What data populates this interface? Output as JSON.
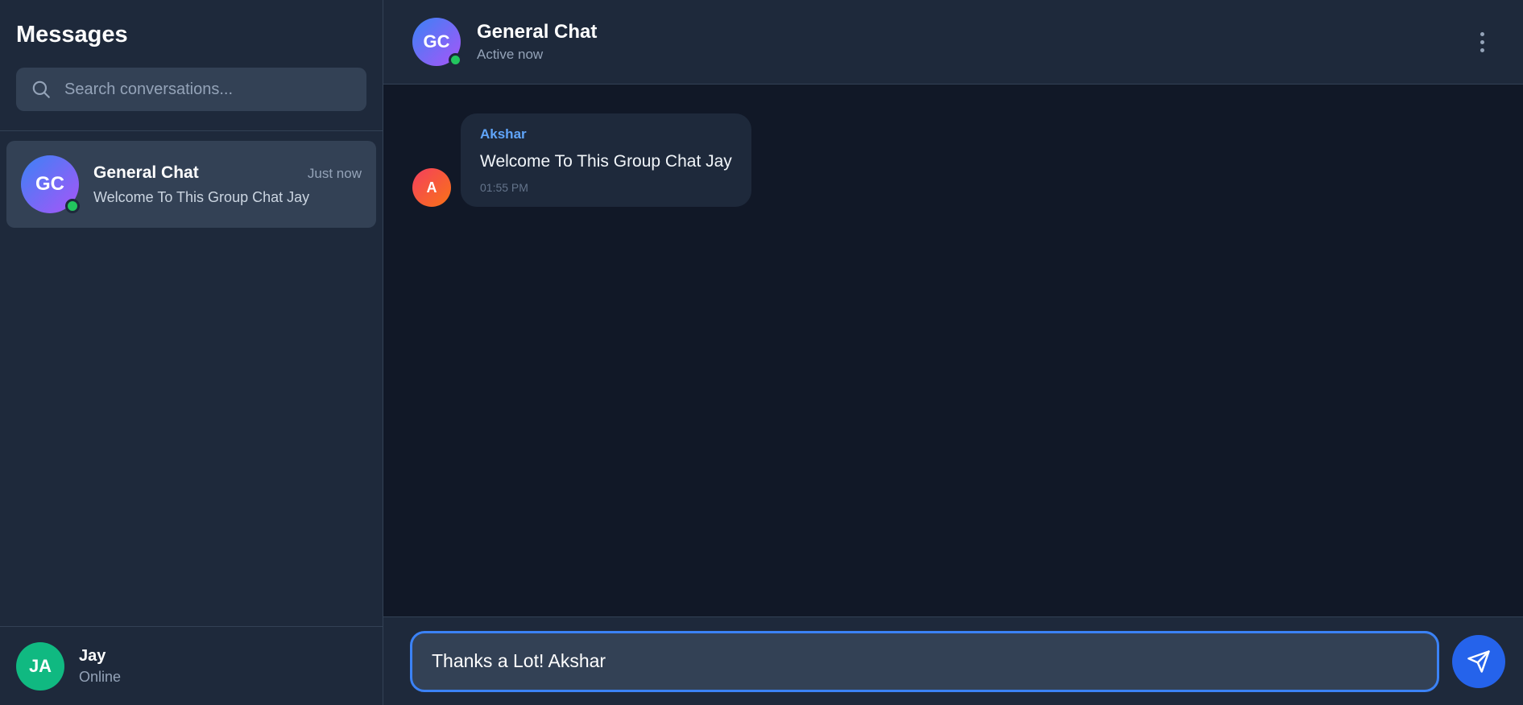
{
  "sidebar": {
    "title": "Messages",
    "search": {
      "placeholder": "Search conversations...",
      "value": ""
    },
    "conversations": [
      {
        "initials": "GC",
        "name": "General Chat",
        "time": "Just now",
        "preview": "Welcome To This Group Chat Jay",
        "online": true
      }
    ],
    "current_user": {
      "initials": "JA",
      "name": "Jay",
      "status": "Online"
    }
  },
  "chat": {
    "header": {
      "initials": "GC",
      "name": "General Chat",
      "status": "Active now"
    },
    "messages": [
      {
        "avatar": "A",
        "sender": "Akshar",
        "text": "Welcome To This Group Chat Jay",
        "time": "01:55 PM"
      }
    ],
    "composer": {
      "value": "Thanks a Lot! Akshar"
    }
  },
  "icons": {
    "search": "search-icon",
    "more": "more-vertical-icon",
    "send": "send-icon"
  },
  "colors": {
    "accent": "#3b82f6",
    "online": "#22c55e",
    "sender_name": "#60a5fa",
    "sidebar_bg": "#1e293b",
    "chat_bg": "#111827"
  }
}
